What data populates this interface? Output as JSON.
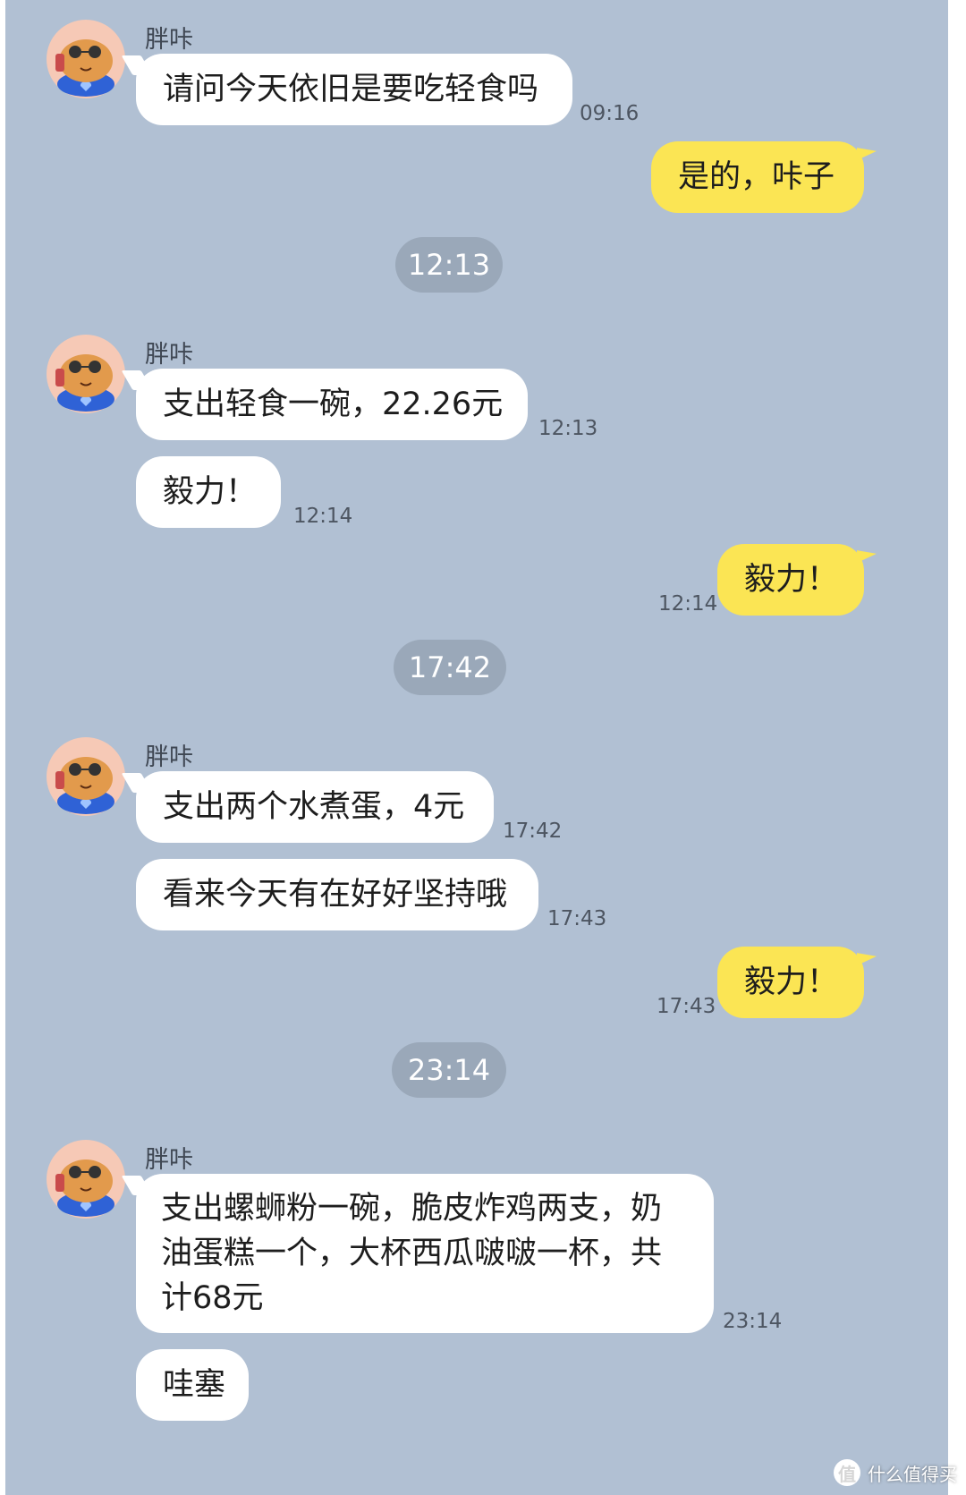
{
  "conversation": {
    "sender_name": "胖咔",
    "messages": [
      {
        "text": "请问今天依旧是要吃轻食吗",
        "time": "09:16"
      },
      {
        "text": "是的，咔子"
      },
      {
        "divider": "12:13"
      },
      {
        "text": "支出轻食一碗，22.26元",
        "time": "12:13"
      },
      {
        "text": "毅力！",
        "time": "12:14"
      },
      {
        "text": "毅力！",
        "time": "12:14"
      },
      {
        "divider": "17:42"
      },
      {
        "text": "支出两个水煮蛋，4元",
        "time": "17:42"
      },
      {
        "text": "看来今天有在好好坚持哦",
        "time": "17:43"
      },
      {
        "text": "毅力！",
        "time": "17:43"
      },
      {
        "divider": "23:14"
      },
      {
        "text": "支出螺蛳粉一碗，脆皮炸鸡两支，奶油蛋糕一个，大杯西瓜啵啵一杯，共计68元",
        "time": "23:14"
      },
      {
        "text": "哇塞"
      }
    ]
  },
  "watermark": {
    "logo": "值",
    "text": "什么值得买"
  },
  "colors": {
    "background": "#b1c0d3",
    "incoming_bubble": "#ffffff",
    "outgoing_bubble": "#fbe554",
    "divider_pill": "#9aa8b9"
  }
}
